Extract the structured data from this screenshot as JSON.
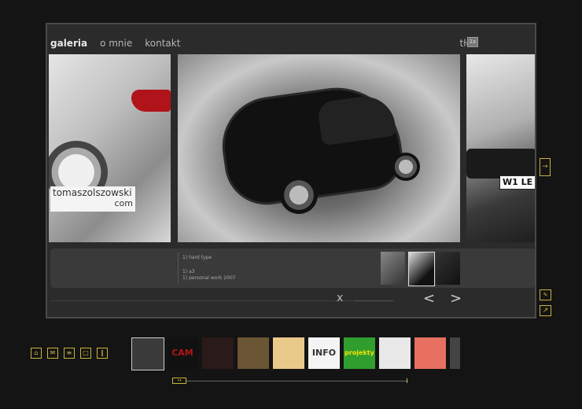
{
  "nav": {
    "items": [
      "galeria",
      "o mnie",
      "kontakt"
    ],
    "tlo_label": "tło"
  },
  "brand": {
    "name": "tomaszolszowski",
    "tld": "com"
  },
  "plate": "W1 LE",
  "info": {
    "line1": "1) hard type",
    "line2": "1) a3",
    "line3": "1) personal work 2007"
  },
  "controls": {
    "close": "x",
    "prev": "<",
    "next": ">"
  },
  "strip": {
    "thumbs": [
      {
        "name": "car-thumb",
        "bg": "#3a3a3a"
      },
      {
        "name": "cam-thumb",
        "text": "CAM",
        "bg": "#111111",
        "color": "#b01515"
      },
      {
        "name": "emblem-thumb",
        "bg": "#2a1a1a"
      },
      {
        "name": "bottle-thumb",
        "bg": "#6a5535"
      },
      {
        "name": "icon-thumb",
        "bg": "#e9c98a"
      },
      {
        "name": "info-thumb",
        "text": "INFO",
        "bg": "#f4f4f4",
        "color": "#333333"
      },
      {
        "name": "projekty-thumb",
        "text": "projekty",
        "bg": "#2f9e2f",
        "color": "#f4e200"
      },
      {
        "name": "people-thumb",
        "bg": "#e8e8e8"
      },
      {
        "name": "red-thumb",
        "bg": "#e87060"
      },
      {
        "name": "edge-thumb",
        "bg": "#444444"
      }
    ]
  },
  "colors": {
    "accent": "#c9b33a"
  }
}
